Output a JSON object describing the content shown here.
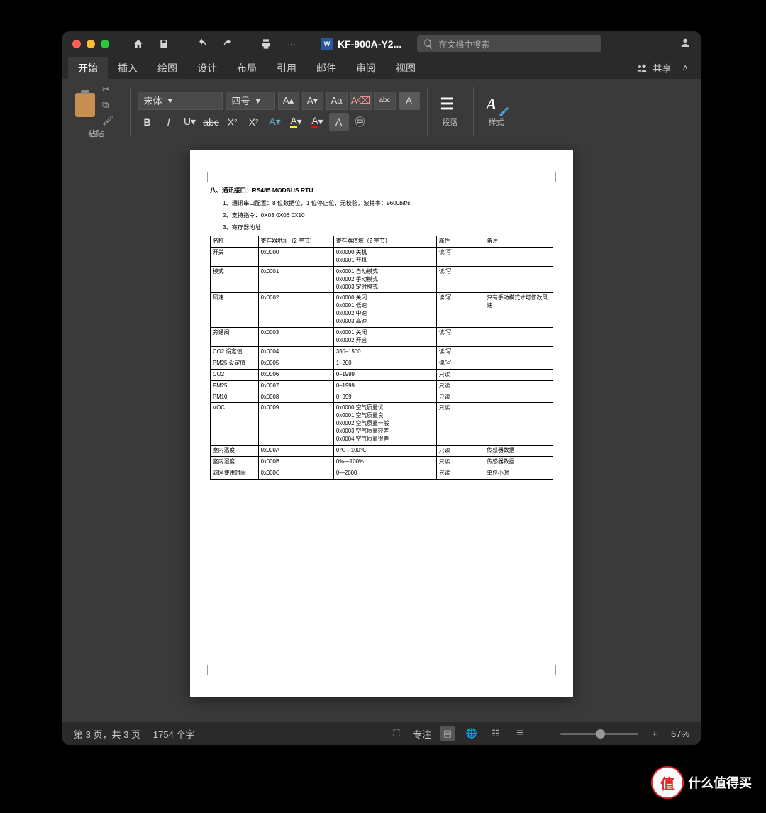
{
  "title": "KF-900A-Y2...",
  "search_placeholder": "在文档中搜索",
  "tabs": [
    "开始",
    "插入",
    "绘图",
    "设计",
    "布局",
    "引用",
    "邮件",
    "审阅",
    "视图"
  ],
  "active_tab": "开始",
  "share": "共享",
  "ribbon": {
    "paste": "粘贴",
    "font_name": "宋体",
    "font_size": "四号",
    "paragraph": "段落",
    "styles": "样式"
  },
  "status": {
    "page": "第 3 页，共 3 页",
    "words": "1754 个字",
    "focus": "专注",
    "zoom": "67%"
  },
  "doc": {
    "heading": "八、通讯接口：RS485   MODBUS   RTU",
    "li1": "1、通讯串口配置：8 位数据位，1 位停止位，无校验，波特率：9600bit/s",
    "li2": "2、支持指令：0X03   0X06   0X10",
    "li3": "3、寄存器地址",
    "cols": [
      "名称",
      "寄存器地址（2 字节）",
      "寄存器值域（2 字节）",
      "属性",
      "备注"
    ],
    "rows": [
      {
        "c": [
          "开关",
          "0x0000",
          "0x0000  关机\n0x0001  开机",
          "读/写",
          ""
        ]
      },
      {
        "c": [
          "模式",
          "0x0001",
          "0x0001  自动模式\n0x0002  手动模式\n0x0003  定时模式",
          "读/写",
          ""
        ]
      },
      {
        "c": [
          "风速",
          "0x0002",
          "0x0000  关闭\n0x0001  低速\n0x0002  中速\n0x0003  高速",
          "读/写",
          "只有手动模式才可修改风速"
        ]
      },
      {
        "c": [
          "旁通阀",
          "0x0003",
          "0x0001  关闭\n0x0002  开启",
          "读/写",
          ""
        ]
      },
      {
        "c": [
          "CO2 设定值",
          "0x0004",
          "350–1500",
          "读/写",
          ""
        ]
      },
      {
        "c": [
          "PM25 设定值",
          "0x0005",
          "1–200",
          "读/写",
          ""
        ]
      },
      {
        "c": [
          "CO2",
          "0x0006",
          "0–1999",
          "只读",
          ""
        ]
      },
      {
        "c": [
          "PM25",
          "0x0007",
          "0–1999",
          "只读",
          ""
        ]
      },
      {
        "c": [
          "PM10",
          "0x0008",
          "0–999",
          "只读",
          ""
        ]
      },
      {
        "c": [
          "VOC",
          "0x0009",
          "0x0000    空气质量优\n0x0001    空气质量良\n0x0002    空气质量一般\n0x0003    空气质量较差\n0x0004    空气质量很差",
          "只读",
          ""
        ]
      },
      {
        "c": [
          "室内温度",
          "0x000A",
          "0℃—100℃",
          "只读",
          "传感器数据"
        ]
      },
      {
        "c": [
          "室内湿度",
          "0x000B",
          "0%—100%",
          "只读",
          "传感器数据"
        ]
      },
      {
        "c": [
          "滤网使用时间",
          "0x000C",
          "0—2000",
          "只读",
          "单位小时"
        ]
      }
    ]
  },
  "watermark": {
    "symbol": "值",
    "text": "什么值得买"
  }
}
